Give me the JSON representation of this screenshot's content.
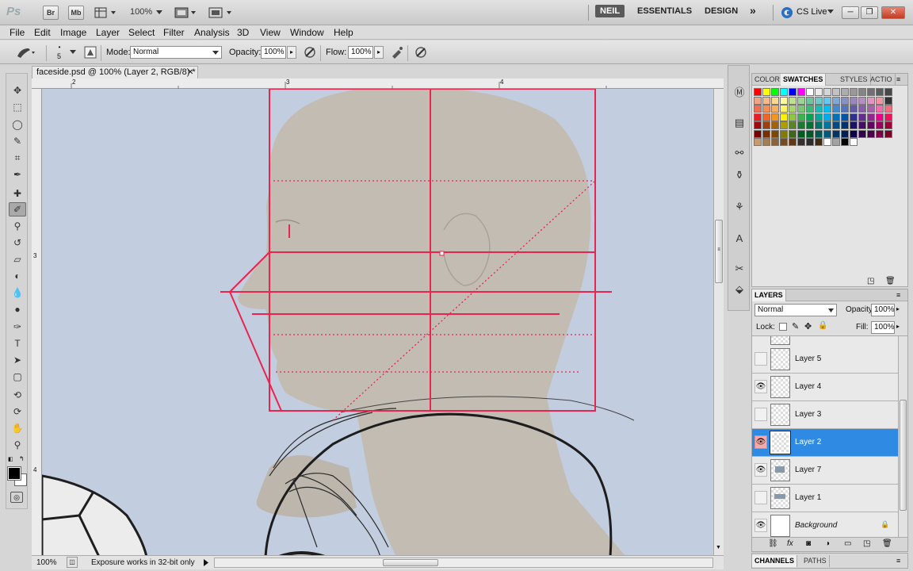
{
  "appbar": {
    "logo": "Ps",
    "bridge_label": "Br",
    "minibridge_label": "Mb",
    "zoom": "100%",
    "workspaces": [
      "NEIL",
      "ESSENTIALS",
      "DESIGN"
    ],
    "more": "»",
    "cslive": "CS Live",
    "window_controls": [
      "─",
      "❐",
      "✕"
    ]
  },
  "menubar": {
    "items": [
      "File",
      "Edit",
      "Image",
      "Layer",
      "Select",
      "Filter",
      "Analysis",
      "3D",
      "View",
      "Window",
      "Help"
    ]
  },
  "options": {
    "brush_size": "5",
    "mode_label": "Mode:",
    "mode_value": "Normal",
    "opacity_label": "Opacity:",
    "opacity_value": "100%",
    "flow_label": "Flow:",
    "flow_value": "100%"
  },
  "document": {
    "tab_title": "faceside.psd @ 100% (Layer 2, RGB/8) *",
    "tab_close": "✕",
    "ruler_h_labels": [
      "2",
      "3",
      "4"
    ],
    "ruler_v_labels": [
      "3",
      "4"
    ]
  },
  "status": {
    "zoom": "100%",
    "message": "Exposure works in 32-bit only"
  },
  "swatches": {
    "tabs": [
      "COLOR",
      "SWATCHES",
      "STYLES",
      "ACTIO"
    ],
    "active_tab": "SWATCHES",
    "rows": [
      [
        "#ff0000",
        "#ffff00",
        "#00ff00",
        "#00ffff",
        "#0000ff",
        "#ff00ff",
        "#ffffff",
        "#ebebeb",
        "#d6d6d6",
        "#c2c2c2",
        "#adadad",
        "#999999",
        "#858585",
        "#707070",
        "#5c5c5c",
        "#474747"
      ],
      [
        "#f2a285",
        "#f7b88a",
        "#fdd98f",
        "#fff99d",
        "#c2df8f",
        "#9bd495",
        "#6bc6a0",
        "#6ccbc8",
        "#64c8f0",
        "#7fa8d8",
        "#8791c8",
        "#9a86c0",
        "#b48ec1",
        "#e494c0",
        "#f196a1",
        "#333333"
      ],
      [
        "#f26c4f",
        "#f68e56",
        "#fbaf5d",
        "#fff467",
        "#acd373",
        "#7cc576",
        "#3bb878",
        "#1abbb4",
        "#00bff3",
        "#438ccb",
        "#5574b9",
        "#605ca8",
        "#855fa8",
        "#a763a9",
        "#f06ea9",
        "#f26d7d"
      ],
      [
        "#ed1c24",
        "#f26522",
        "#f7941d",
        "#fff200",
        "#8dc63f",
        "#39b54a",
        "#00a651",
        "#00a99d",
        "#00aeef",
        "#0072bc",
        "#0054a6",
        "#2e3192",
        "#662d91",
        "#92278f",
        "#ec008c",
        "#ed145b"
      ],
      [
        "#9e0b0f",
        "#a0410d",
        "#a36209",
        "#aba000",
        "#598527",
        "#1a7b30",
        "#007236",
        "#00746b",
        "#0076a3",
        "#004b80",
        "#003471",
        "#1b1464",
        "#440e62",
        "#630460",
        "#9e005d",
        "#9e0039"
      ],
      [
        "#790000",
        "#7b2e00",
        "#7d4900",
        "#827b00",
        "#406618",
        "#005e20",
        "#005826",
        "#005952",
        "#005b7f",
        "#003663",
        "#002157",
        "#0d004c",
        "#32004b",
        "#4b0049",
        "#7b0046",
        "#7a0026"
      ],
      [
        "#c69c6d",
        "#a67c52",
        "#8c6239",
        "#754c24",
        "#603913",
        "#362f2d",
        "#2b2b2b",
        "#3e2a14",
        "#ffffff",
        "#a3a3a3",
        "#000000",
        "#ffffff"
      ]
    ]
  },
  "layers": {
    "title": "LAYERS",
    "blend_mode": "Normal",
    "opacity_label": "Opacity:",
    "opacity_value": "100%",
    "lock_label": "Lock:",
    "fill_label": "Fill:",
    "fill_value": "100%",
    "items": [
      {
        "name": "Layer 5",
        "visible": false,
        "selected": false
      },
      {
        "name": "Layer 4",
        "visible": true,
        "selected": false
      },
      {
        "name": "Layer 3",
        "visible": false,
        "selected": false
      },
      {
        "name": "Layer 2",
        "visible": true,
        "selected": true
      },
      {
        "name": "Layer 7",
        "visible": true,
        "selected": false
      },
      {
        "name": "Layer 1",
        "visible": false,
        "selected": false
      },
      {
        "name": "Background",
        "visible": true,
        "selected": false
      }
    ]
  },
  "bottom_tabs": [
    "CHANNELS",
    "PATHS"
  ],
  "colors": {
    "guide_red": "#e8244f",
    "selection_blue": "#2f8ae4",
    "canvas_bg": "#c2cedf",
    "skin": "#c3bcb3"
  }
}
